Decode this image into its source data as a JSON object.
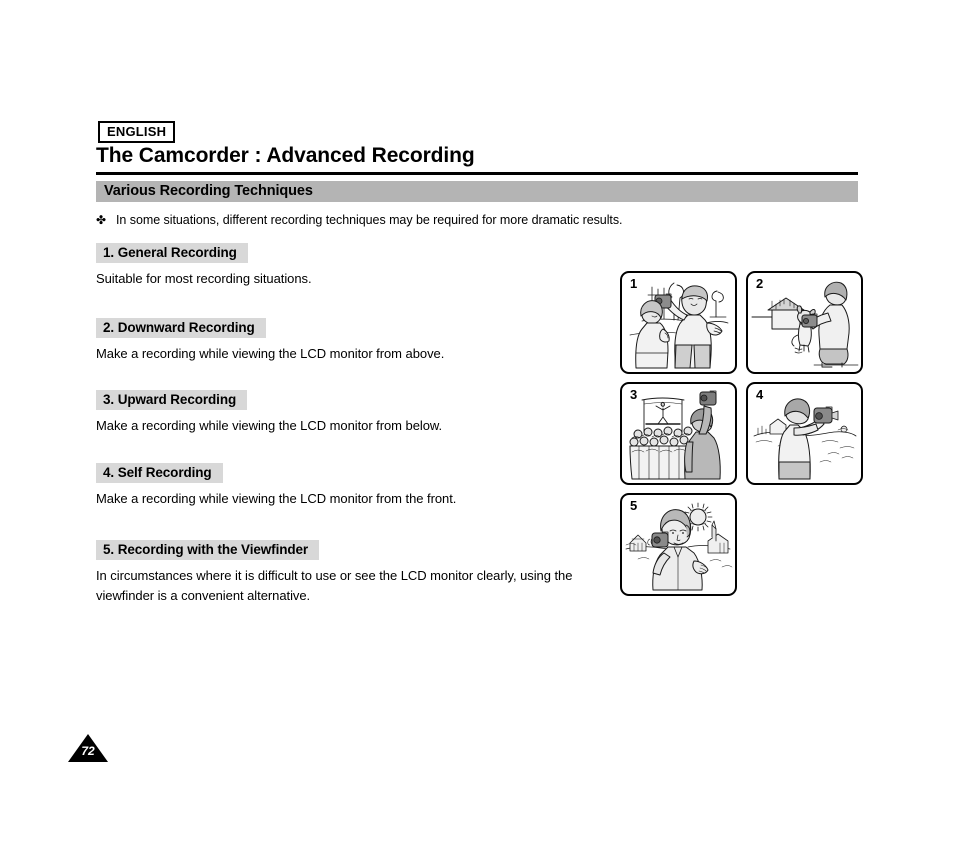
{
  "header": {
    "language_badge": "ENGLISH",
    "title": "The Camcorder : Advanced Recording"
  },
  "section": {
    "bar_title": "Various Recording Techniques",
    "intro_bullet": "✤",
    "intro_text": "In some situations, different recording techniques may be required for more dramatic results."
  },
  "techniques": [
    {
      "label": "1. General Recording",
      "body": "Suitable for most recording situations."
    },
    {
      "label": "2. Downward Recording",
      "body": "Make a recording while viewing the LCD monitor from above."
    },
    {
      "label": "3. Upward Recording",
      "body": "Make a recording while viewing the LCD monitor from below."
    },
    {
      "label": "4. Self Recording",
      "body": "Make a recording while viewing the LCD monitor from the front."
    },
    {
      "label": "5. Recording with the Viewfinder",
      "body": "In circumstances where it is difficult to use or see the LCD monitor clearly, using the viewfinder is a convenient alternative."
    }
  ],
  "illustrations": [
    {
      "number": "1",
      "caption": "general-recording-two-people-outdoors"
    },
    {
      "number": "2",
      "caption": "downward-recording-crouching-man-filming-dog"
    },
    {
      "number": "3",
      "caption": "upward-recording-man-holding-camcorder-above-crowd"
    },
    {
      "number": "4",
      "caption": "self-recording-man-filming-landscape"
    },
    {
      "number": "5",
      "caption": "viewfinder-recording-man-with-camcorder-sunny-day"
    }
  ],
  "footer": {
    "page_number": "72"
  },
  "colors": {
    "section_bar_gray": "#b4b4b4",
    "label_gray": "#d8d8d8",
    "ink": "#000000",
    "figure_fill": "#c8c8c8",
    "figure_fill_light": "#e6e6e6"
  }
}
